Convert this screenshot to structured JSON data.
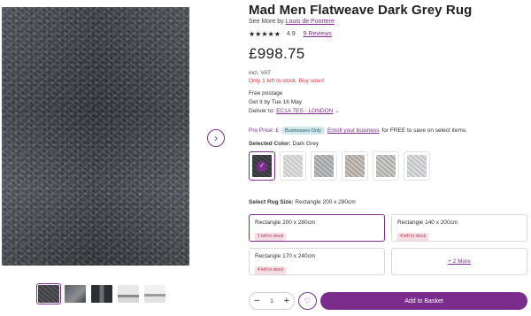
{
  "product": {
    "title": "Mad Men Flatweave Dark Grey Rug",
    "see_more_prefix": "See More by",
    "brand": "Louis de Poortere",
    "stars": "★★★★★",
    "rating": "4.9",
    "reviews": "9 Reviews",
    "price": "£998.75",
    "vat": "incl. VAT",
    "stock_warning": "Only 1 left in stock. Buy soon!"
  },
  "delivery": {
    "postage": "Free postage",
    "get_by": "Get it by Tue 16 May",
    "deliver_to_label": "Deliver to:",
    "postcode": "EC1A 7ES - LONDON"
  },
  "pro_price": {
    "label": "Pro Price: £",
    "badge": "Businesses Only",
    "enroll_link": "Enroll your business",
    "suffix": "for FREE to save on select items."
  },
  "color": {
    "label": "Selected Color:",
    "value": "Dark Grey"
  },
  "size": {
    "label": "Select Rug Size:",
    "value": "Rectangle 200 x 280cm",
    "options": [
      {
        "name": "Rectangle 200 x 280cm",
        "stock": "1 left in stock"
      },
      {
        "name": "Rectangle 140 x 200cm",
        "stock": "4 left in stock"
      },
      {
        "name": "Rectangle 170 x 240cm",
        "stock": "4 left in stock"
      }
    ],
    "more": "+ 2 More"
  },
  "actions": {
    "minus": "−",
    "quantity": "1",
    "plus": "+",
    "wishlist_icon": "heart-icon",
    "add_to_basket": "Add to Basket"
  },
  "colors": {
    "accent": "#7b2d8e",
    "warning": "#d63b3b",
    "stock_badge_bg": "#f7dde4"
  }
}
